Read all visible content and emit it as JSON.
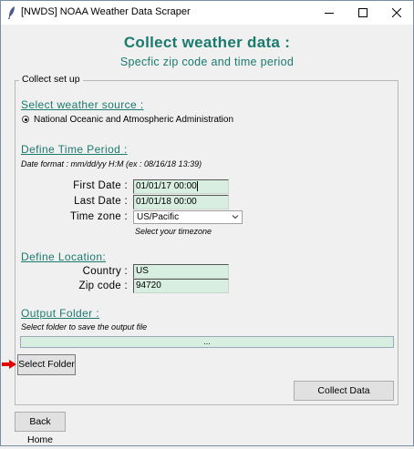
{
  "window": {
    "title": "[NWDS] NOAA Weather Data Scraper",
    "minimize": "—",
    "maximize": "☐",
    "close": "✕"
  },
  "header": {
    "title": "Collect weather data :",
    "subtitle": "Specfic zip code and time period"
  },
  "group": {
    "legend": "Collect set up"
  },
  "source": {
    "heading": "Select weather source :",
    "option_label": "National Oceanic and Atmospheric Administration",
    "selected": true
  },
  "time": {
    "heading": "Define Time Period :",
    "format_note": "Date format : mm/dd/yy H:M  (ex : 08/16/18 13:39)",
    "first_label": "First Date :",
    "first_value": "01/01/17 00:00",
    "last_label": "Last Date :",
    "last_value": "01/01/18 00:00",
    "tz_label": "Time zone :",
    "tz_value": "US/Pacific",
    "tz_note": "Select your timezone"
  },
  "location": {
    "heading": "Define Location:",
    "country_label": "Country :",
    "country_value": "US",
    "zip_label": "Zip code :",
    "zip_value": "94720"
  },
  "output": {
    "heading": "Output Folder :",
    "note": "Select folder to save the output file",
    "path": "...",
    "select_button": "Select Folder"
  },
  "buttons": {
    "collect": "Collect Data",
    "back": "Back Home"
  },
  "colors": {
    "accent": "#1b7a6e",
    "entry_bg": "#d7eee1",
    "arrow": "#e00000"
  }
}
